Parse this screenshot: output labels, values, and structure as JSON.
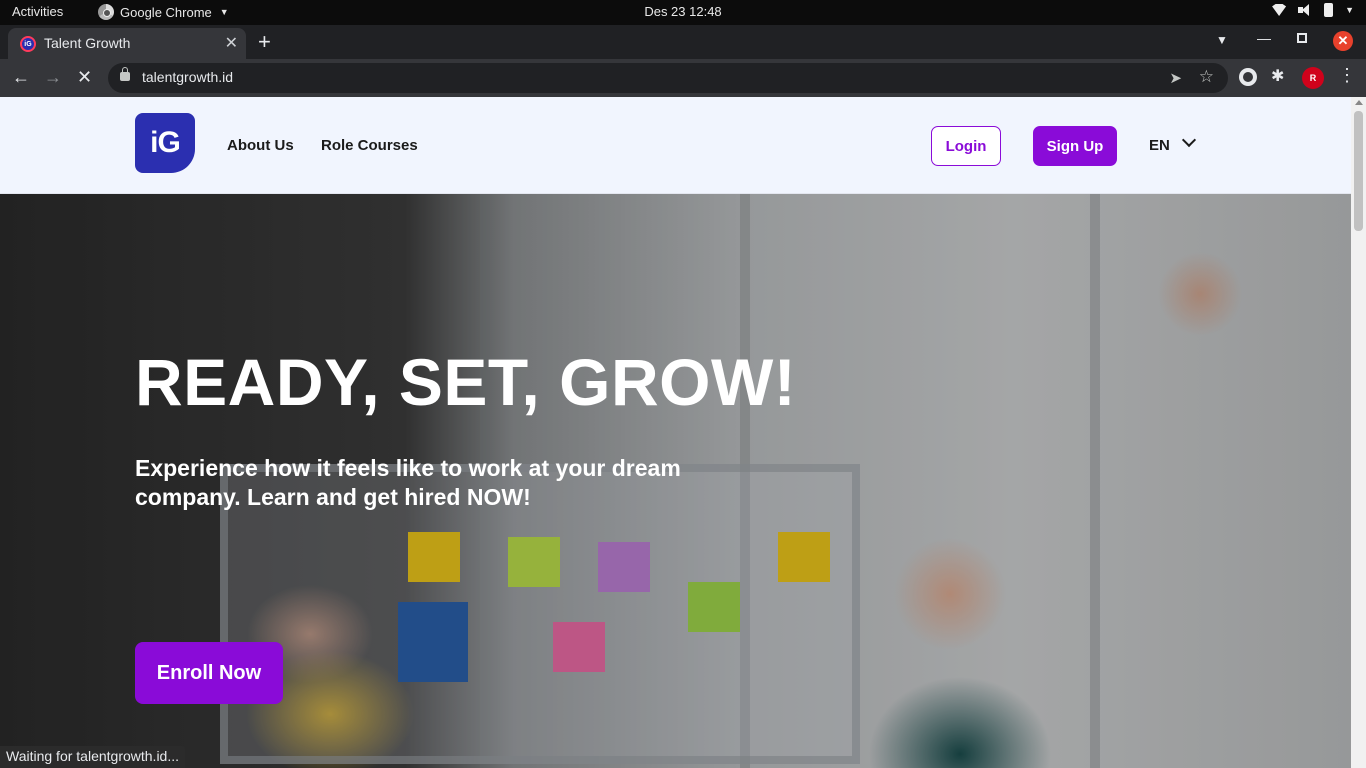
{
  "system": {
    "activities": "Activities",
    "app_name": "Google Chrome",
    "clock": "Des 23  12:48"
  },
  "browser": {
    "tab_title": "Talent Growth",
    "tab_favicon_text": "iG",
    "url": "talentgrowth.id",
    "profile_initials": "R",
    "status": "Waiting for talentgrowth.id..."
  },
  "site": {
    "logo_text": "iG",
    "nav": {
      "about": "About Us",
      "roles": "Role Courses"
    },
    "login": "Login",
    "signup": "Sign Up",
    "language": "EN",
    "hero": {
      "title": "READY, SET, GROW!",
      "subtitle": "Experience how it feels like to work at your dream company. Learn and get hired NOW!",
      "cta": "Enroll Now"
    }
  },
  "colors": {
    "brand_purple": "#8a0bd8",
    "logo_blue": "#2b2fb0",
    "header_bg": "#f1f5fe"
  }
}
